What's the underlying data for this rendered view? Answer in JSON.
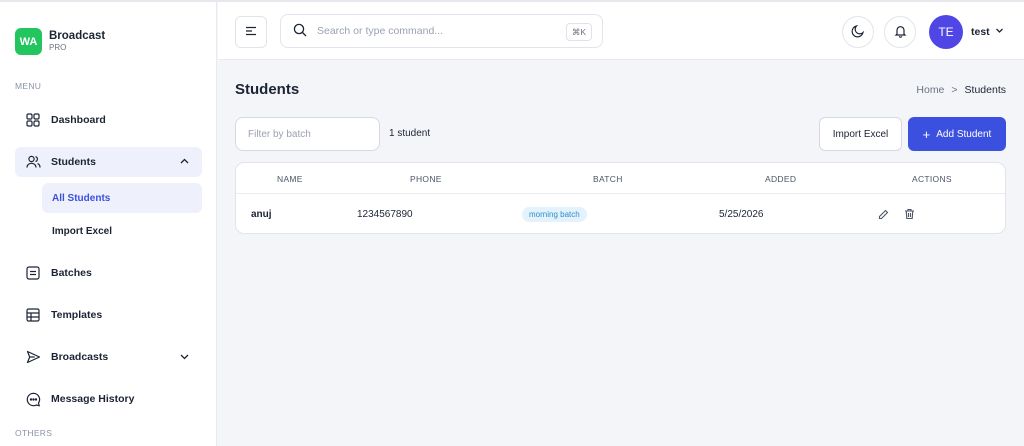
{
  "brand": {
    "logo": "WA",
    "name": "Broadcast",
    "sub": "PRO"
  },
  "sidebar": {
    "menu_label": "MENU",
    "others_label": "OTHERS",
    "items": [
      {
        "label": "Dashboard",
        "icon": "grid-icon"
      },
      {
        "label": "Students",
        "icon": "users-icon",
        "expanded": true
      },
      {
        "label": "Batches",
        "icon": "list-icon"
      },
      {
        "label": "Templates",
        "icon": "table-icon"
      },
      {
        "label": "Broadcasts",
        "icon": "send-icon"
      },
      {
        "label": "Message History",
        "icon": "chat-icon"
      }
    ],
    "students_sub": [
      {
        "label": "All Students",
        "active": true
      },
      {
        "label": "Import Excel"
      }
    ]
  },
  "header": {
    "search_placeholder": "Search or type command...",
    "shortcut": "⌘K",
    "avatar_initials": "TE",
    "user_name": "test"
  },
  "page": {
    "title": "Students",
    "breadcrumb": {
      "home": "Home",
      "sep": ">",
      "current": "Students"
    },
    "filter_placeholder": "Filter by batch",
    "count": "1 student",
    "import_label": "Import Excel",
    "add_label": "Add Student"
  },
  "table": {
    "headers": [
      "NAME",
      "PHONE",
      "BATCH",
      "ADDED",
      "ACTIONS"
    ],
    "rows": [
      {
        "name": "anuj",
        "phone": "1234567890",
        "batch": "morning batch",
        "added": "5/25/2026"
      }
    ]
  },
  "colors": {
    "primary": "#3c50e0",
    "brand": "#22c55e",
    "avatar": "#4f46e5",
    "badge_bg": "#e3f2fb",
    "badge_text": "#2b8ed0"
  }
}
